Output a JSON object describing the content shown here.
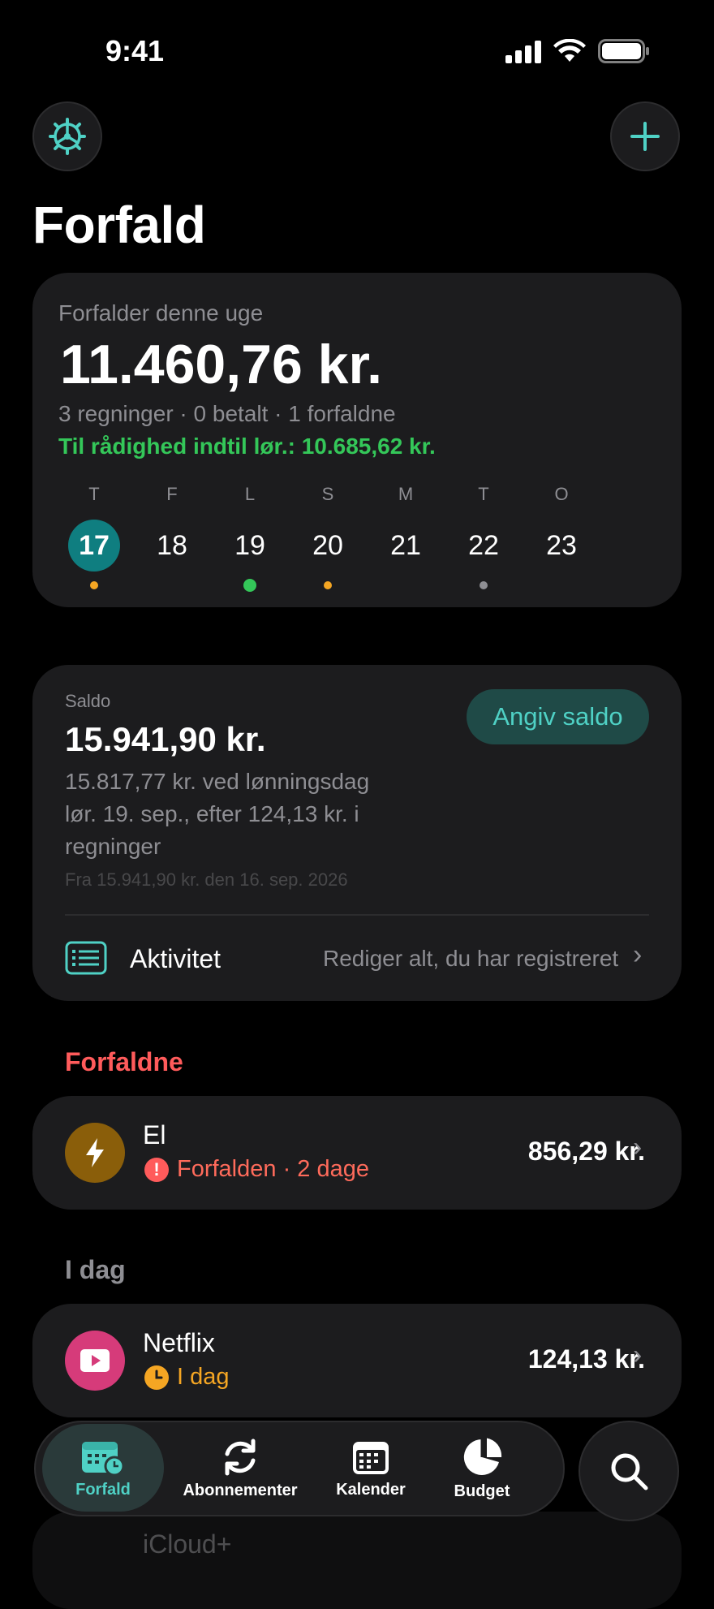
{
  "status": {
    "time": "9:41"
  },
  "header": {
    "title": "Forfald"
  },
  "week": {
    "label": "Forfalder denne uge",
    "amount": "11.460,76 kr.",
    "summary": "3 regninger · 0 betalt · 1 forfaldne",
    "available": "Til rådighed indtil lør.: 10.685,62 kr.",
    "days": [
      {
        "letter": "T",
        "num": "17",
        "selected": true,
        "dot": "#f5a623"
      },
      {
        "letter": "F",
        "num": "18",
        "selected": false,
        "dot": ""
      },
      {
        "letter": "L",
        "num": "19",
        "selected": false,
        "dot": "#34c759"
      },
      {
        "letter": "S",
        "num": "20",
        "selected": false,
        "dot": "#f5a623"
      },
      {
        "letter": "M",
        "num": "21",
        "selected": false,
        "dot": ""
      },
      {
        "letter": "T",
        "num": "22",
        "selected": false,
        "dot": "#8e8e93"
      },
      {
        "letter": "O",
        "num": "23",
        "selected": false,
        "dot": ""
      }
    ]
  },
  "balance": {
    "label": "Saldo",
    "amount": "15.941,90 kr.",
    "set_button": "Angiv saldo",
    "line1": "15.817,77 kr. ved lønningsdag",
    "line2": "lør. 19. sep., efter 124,13 kr. i",
    "line3": "regninger",
    "from": "Fra 15.941,90 kr. den 16. sep. 2026",
    "activity_label": "Aktivitet",
    "activity_hint": "Rediger alt, du har registreret"
  },
  "overdue": {
    "heading": "Forfaldne",
    "items": [
      {
        "name": "El",
        "status": "Forfalden · 2 dage",
        "amount": "856,29 kr."
      }
    ]
  },
  "today": {
    "heading": "I dag",
    "items": [
      {
        "name": "Netflix",
        "status": "I dag",
        "amount": "124,13 kr."
      }
    ]
  },
  "peek": {
    "text": "iCloud+"
  },
  "tabs": [
    {
      "label": "Forfald"
    },
    {
      "label": "Abonnementer"
    },
    {
      "label": "Kalender"
    },
    {
      "label": "Budget"
    }
  ],
  "colors": {
    "accent": "#4fd1c5",
    "green": "#34c759",
    "red": "#ff5b5b",
    "orange": "#f5a623"
  }
}
